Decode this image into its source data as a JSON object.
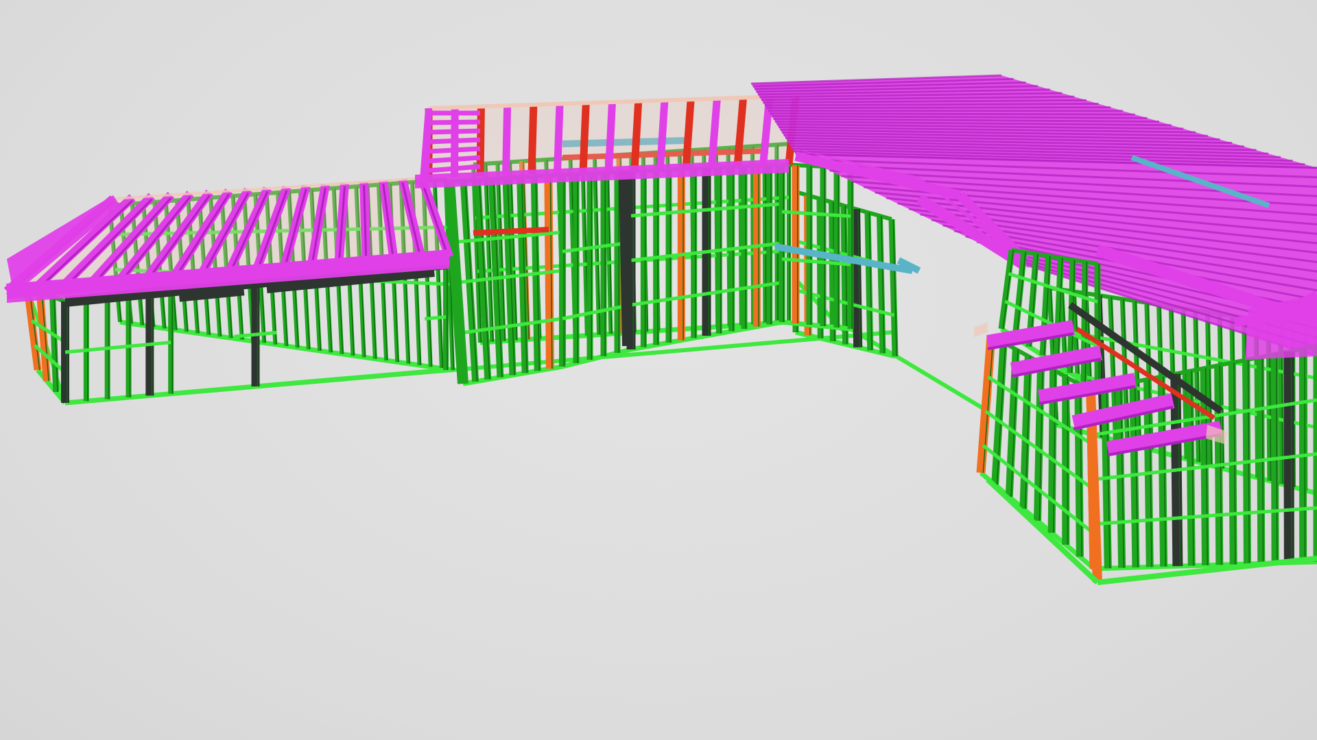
{
  "viewer": {
    "background": "#dedede"
  },
  "model": {
    "colors": {
      "stud": "#1fa61f",
      "stud_dark": "#0e6a10",
      "plate": "#3ee83e",
      "post": "#2e3430",
      "jamb": "#f07020",
      "header": "#e03020",
      "truss": "#e040e8",
      "truss_dark": "#b020c0",
      "brace": "#5ab4c8",
      "sheet": "#f0c8b8"
    },
    "components": [
      "left-wing-wall-frame",
      "left-wing-roof-trusses",
      "center-wall-frame",
      "center-roof-trusses",
      "right-roof-trusses",
      "right-wing-wall-frame",
      "right-wing-bay-trusses"
    ]
  }
}
